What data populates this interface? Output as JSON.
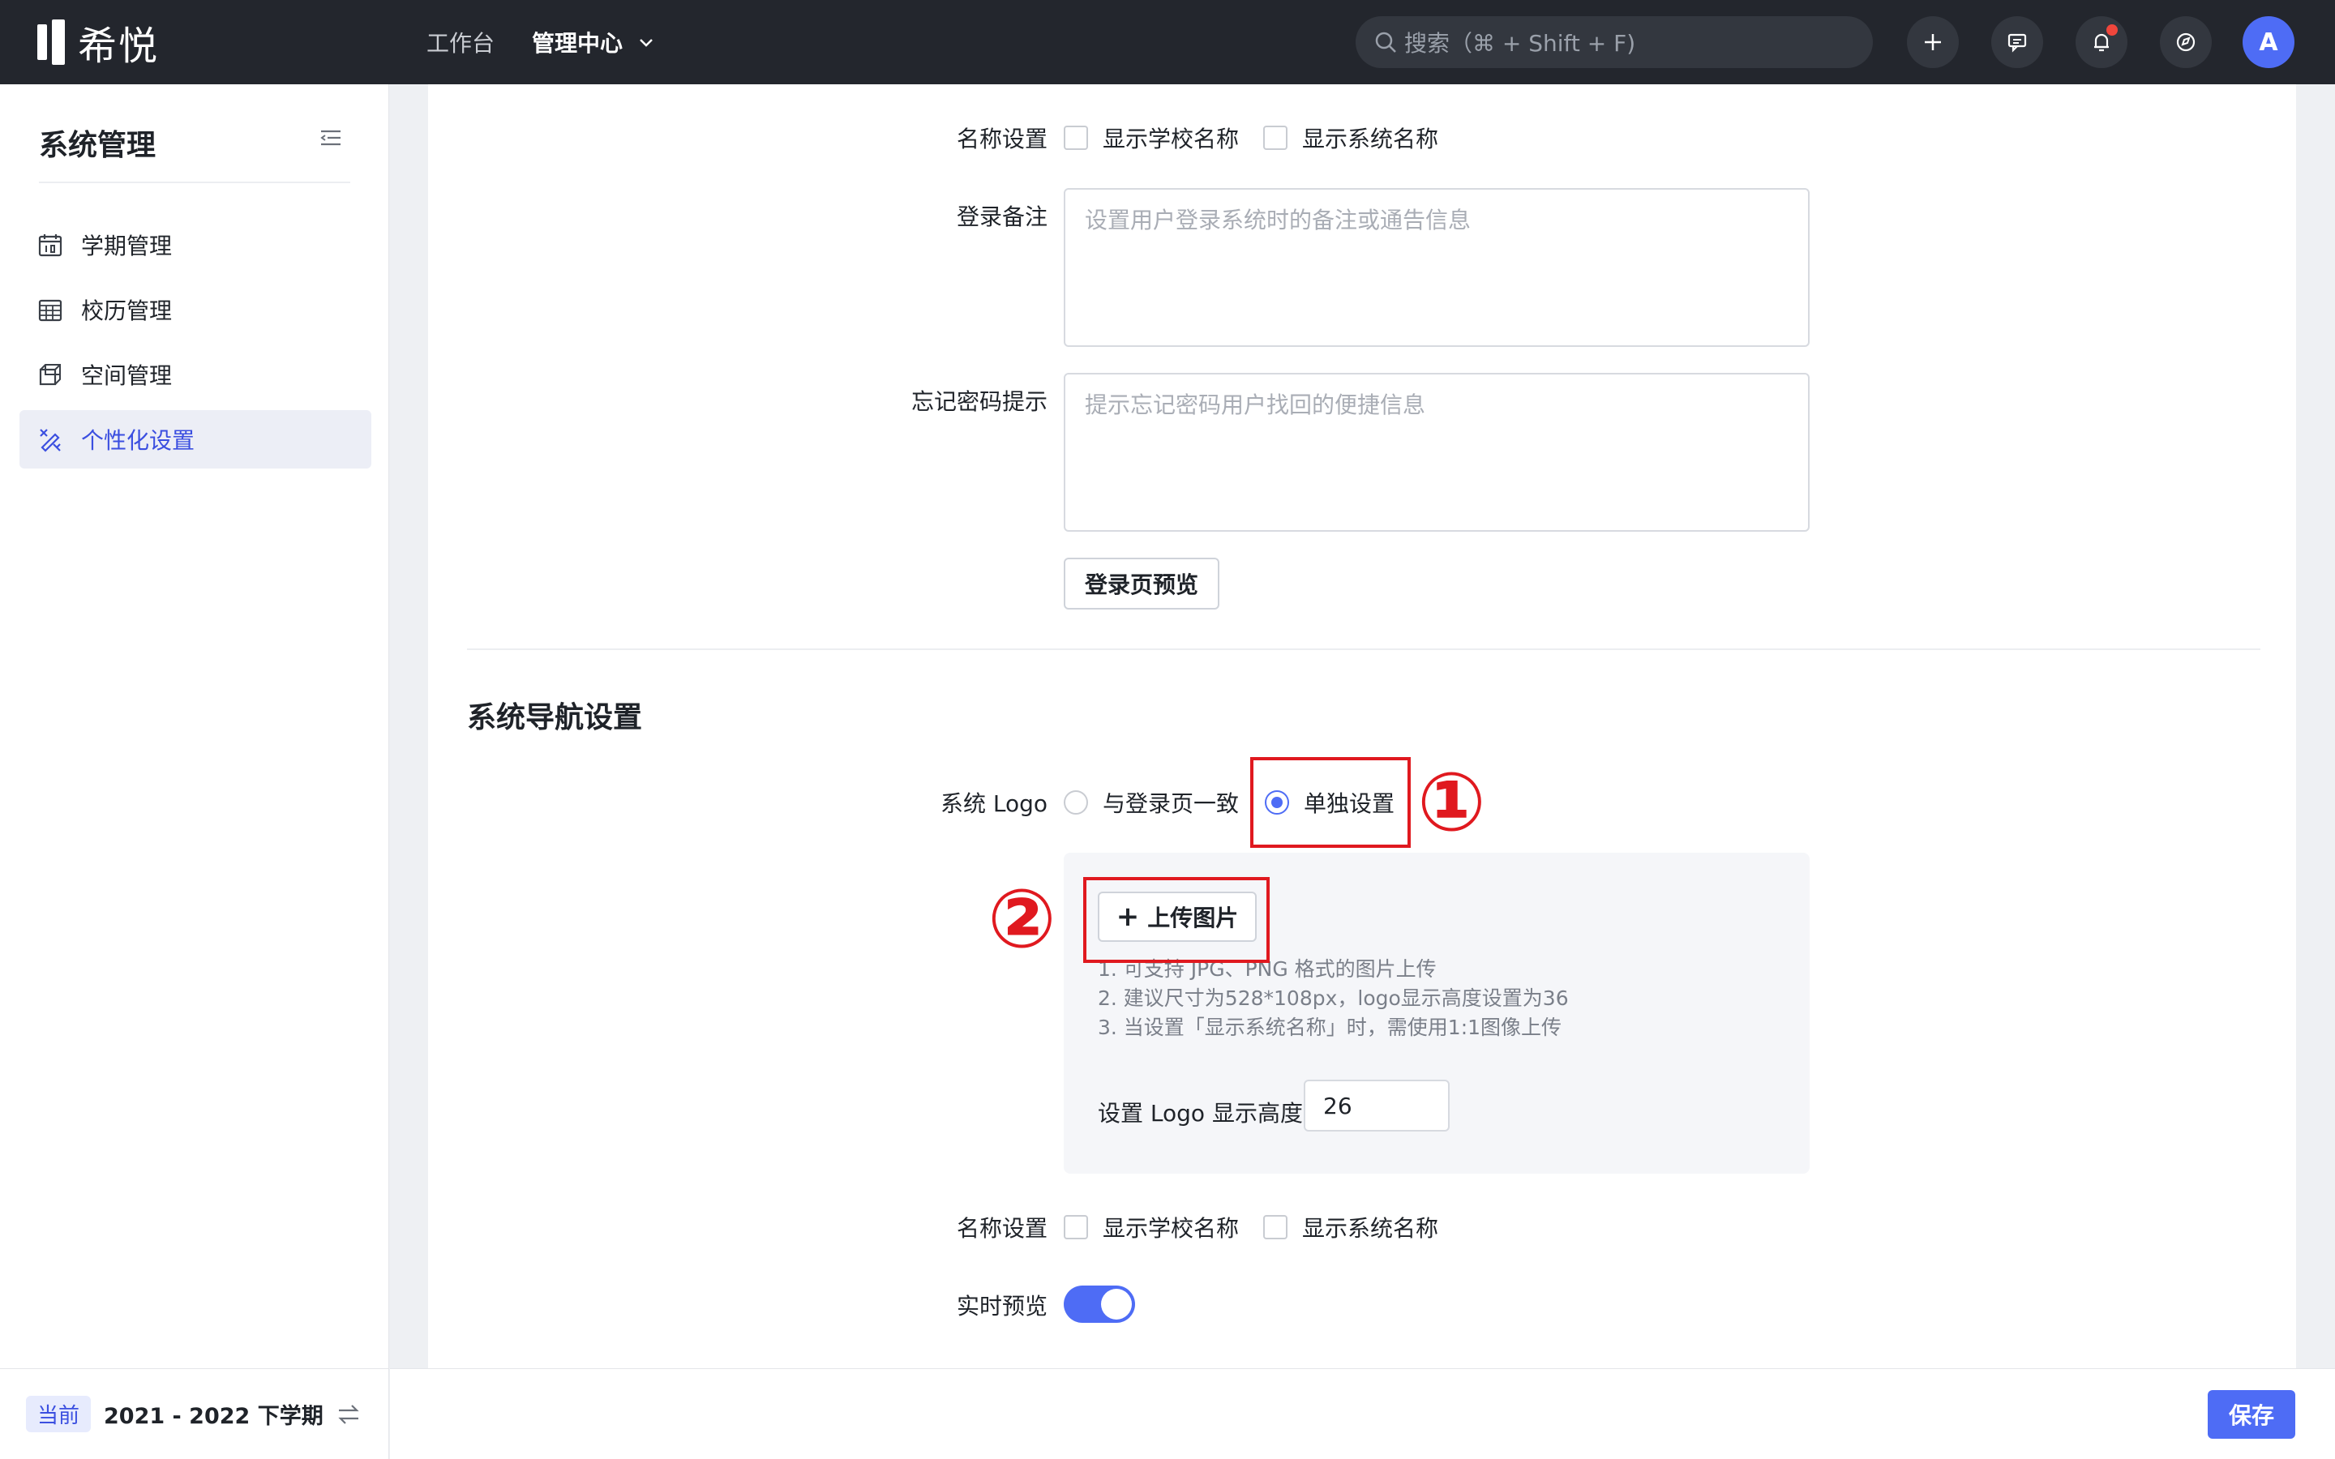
{
  "brand": {
    "name": "希悦"
  },
  "topnav": {
    "items": [
      {
        "label": "工作台"
      },
      {
        "label": "管理中心"
      }
    ]
  },
  "search": {
    "placeholder": "搜索（⌘ + Shift + F)"
  },
  "user": {
    "avatar_letter": "A"
  },
  "sidebar": {
    "title": "系统管理",
    "items": [
      {
        "label": "学期管理",
        "icon": "calendar-icon"
      },
      {
        "label": "校历管理",
        "icon": "grid-calendar-icon"
      },
      {
        "label": "空间管理",
        "icon": "cube-icon"
      },
      {
        "label": "个性化设置",
        "icon": "brush-icon",
        "active": true
      }
    ],
    "term": {
      "tag": "当前",
      "value": "2021 - 2022 下学期"
    }
  },
  "login": {
    "name_label": "名称设置",
    "opt_school": "显示学校名称",
    "opt_system": "显示系统名称",
    "note_label": "登录备注",
    "note_placeholder": "设置用户登录系统时的备注或通告信息",
    "forgot_label": "忘记密码提示",
    "forgot_placeholder": "提示忘记密码用户找回的便捷信息",
    "preview_button": "登录页预览"
  },
  "nav_section": {
    "title": "系统导航设置",
    "logo_label": "系统 Logo",
    "logo_opt_same": "与登录页一致",
    "logo_opt_custom": "单独设置",
    "upload_button": "上传图片",
    "hints": [
      "1. 可支持 JPG、PNG 格式的图片上传",
      "2. 建议尺寸为528*108px，logo显示高度设置为36",
      "3. 当设置「显示系统名称」时，需使用1:1图像上传"
    ],
    "height_label": "设置 Logo 显示高度",
    "height_value": "26",
    "name_label": "名称设置",
    "opt_school": "显示学校名称",
    "opt_system": "显示系统名称",
    "preview_label": "实时预览"
  },
  "annotations": {
    "one": "①",
    "two": "②"
  },
  "footer": {
    "save_button": "保存"
  },
  "colors": {
    "accent": "#4e6cf5",
    "topbar": "#23262d",
    "annotation": "#e0191f"
  }
}
